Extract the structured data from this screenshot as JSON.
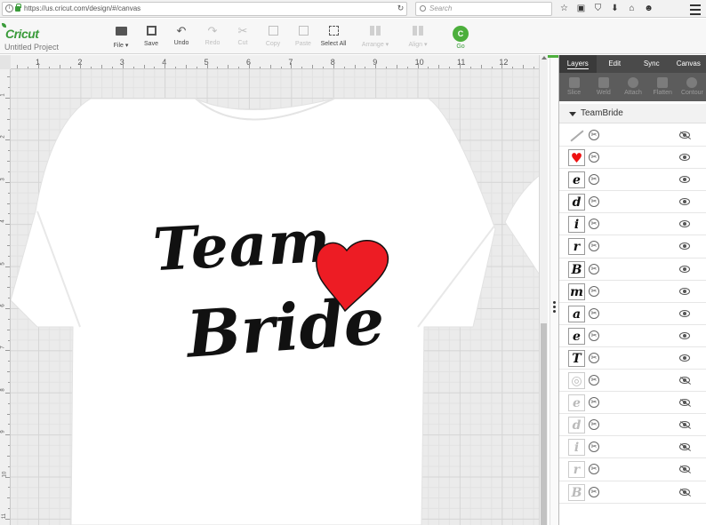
{
  "browser": {
    "url": "https://us.cricut.com/design/#/canvas",
    "reload_icon": "reload-icon",
    "search_placeholder": "Search",
    "icons": [
      "star-icon",
      "clipboard-icon",
      "pocket-icon",
      "download-icon",
      "home-icon",
      "smiley-icon"
    ],
    "menu_icon": "hamburger-menu-icon"
  },
  "app": {
    "logo": "Cricut",
    "project_name": "Untitled Project",
    "toolbar": [
      {
        "label": "File ▾",
        "icon": "folder-icon",
        "enabled": true
      },
      {
        "label": "Save",
        "icon": "save-icon",
        "enabled": true
      },
      {
        "label": "Undo",
        "icon": "undo-icon",
        "enabled": true
      },
      {
        "label": "Redo",
        "icon": "redo-icon",
        "enabled": false
      },
      {
        "label": "Cut",
        "icon": "cut-icon",
        "enabled": false
      },
      {
        "label": "Copy",
        "icon": "copy-icon",
        "enabled": false
      },
      {
        "label": "Paste",
        "icon": "paste-icon",
        "enabled": false
      },
      {
        "label": "Select All",
        "icon": "select-all-icon",
        "enabled": true
      },
      {
        "label": "Arrange ▾",
        "icon": "arrange-icon",
        "enabled": false
      },
      {
        "label": "Align ▾",
        "icon": "align-icon",
        "enabled": false
      }
    ],
    "go_label": "Go",
    "go_icon_text": "C"
  },
  "ruler": {
    "top_numbers": [
      "1",
      "2",
      "3",
      "4",
      "5",
      "6",
      "7",
      "8",
      "9",
      "10",
      "11",
      "12"
    ],
    "left_numbers": [
      "1",
      "2",
      "3",
      "4",
      "5",
      "6",
      "7",
      "8",
      "9",
      "10",
      "11"
    ]
  },
  "canvas": {
    "text_line_1": "Team",
    "text_line_2": "Bride",
    "heart_color": "#ed1c24",
    "text_color": "#111111"
  },
  "panel": {
    "tabs": [
      {
        "label": "Layers",
        "active": true
      },
      {
        "label": "Edit",
        "active": false
      },
      {
        "label": "Sync",
        "active": false
      },
      {
        "label": "Canvas",
        "active": false
      }
    ],
    "tools": [
      "Slice",
      "Weld",
      "Attach",
      "Flatten",
      "Contour"
    ],
    "group_name": "TeamBride",
    "layers": [
      {
        "thumb": "",
        "kind": "line",
        "visible": false,
        "icon": "line-icon"
      },
      {
        "thumb": "♥",
        "kind": "heart",
        "visible": true,
        "icon": "heart-icon"
      },
      {
        "thumb": "e",
        "kind": "letter",
        "visible": true
      },
      {
        "thumb": "d",
        "kind": "letter",
        "visible": true
      },
      {
        "thumb": "i",
        "kind": "letter",
        "visible": true
      },
      {
        "thumb": "r",
        "kind": "letter",
        "visible": true
      },
      {
        "thumb": "B",
        "kind": "letter",
        "visible": true
      },
      {
        "thumb": "m",
        "kind": "letter",
        "visible": true
      },
      {
        "thumb": "a",
        "kind": "letter",
        "visible": true
      },
      {
        "thumb": "e",
        "kind": "letter",
        "visible": true
      },
      {
        "thumb": "T",
        "kind": "letter",
        "visible": true
      },
      {
        "thumb": "◎",
        "kind": "ring",
        "visible": false,
        "icon": "ring-icon"
      },
      {
        "thumb": "e",
        "kind": "letter",
        "visible": false
      },
      {
        "thumb": "d",
        "kind": "letter",
        "visible": false
      },
      {
        "thumb": "i",
        "kind": "letter",
        "visible": false
      },
      {
        "thumb": "r",
        "kind": "letter",
        "visible": false
      },
      {
        "thumb": "B",
        "kind": "letter",
        "visible": false
      }
    ]
  }
}
